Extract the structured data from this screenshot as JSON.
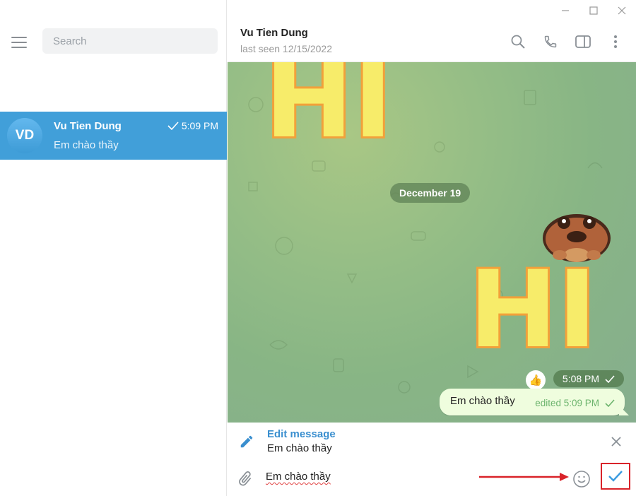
{
  "window": {
    "controls": [
      "minimize",
      "maximize",
      "close"
    ]
  },
  "sidebar": {
    "search_placeholder": "Search",
    "chats": [
      {
        "initials": "VD",
        "name": "Vu Tien Dung",
        "time": "5:09 PM",
        "preview": "Em chào thầy",
        "selected": true,
        "status_icon": "check-icon"
      }
    ]
  },
  "header": {
    "name": "Vu Tien Dung",
    "status": "last seen 12/15/2022",
    "icons": [
      "search-icon",
      "phone-icon",
      "sidebar-toggle-icon",
      "more-vertical-icon"
    ]
  },
  "messages": {
    "sticker_top_text": "HI",
    "date_separator": "December 19",
    "sticker_bottom_text": "HI",
    "reaction": "👍",
    "sticker_time": "5:08 PM",
    "text_message": {
      "text": "Em chào thầy",
      "meta": "edited 5:09 PM"
    }
  },
  "edit": {
    "title": "Edit message",
    "original_text": "Em chào thầy"
  },
  "composer": {
    "value": "Em chào thầy"
  },
  "colors": {
    "accent": "#419fd9",
    "bubble_out": "#effdde",
    "highlight_box": "#d9232a",
    "sticker_fill": "#f7ec6a",
    "sticker_outline": "#f2a13a"
  }
}
